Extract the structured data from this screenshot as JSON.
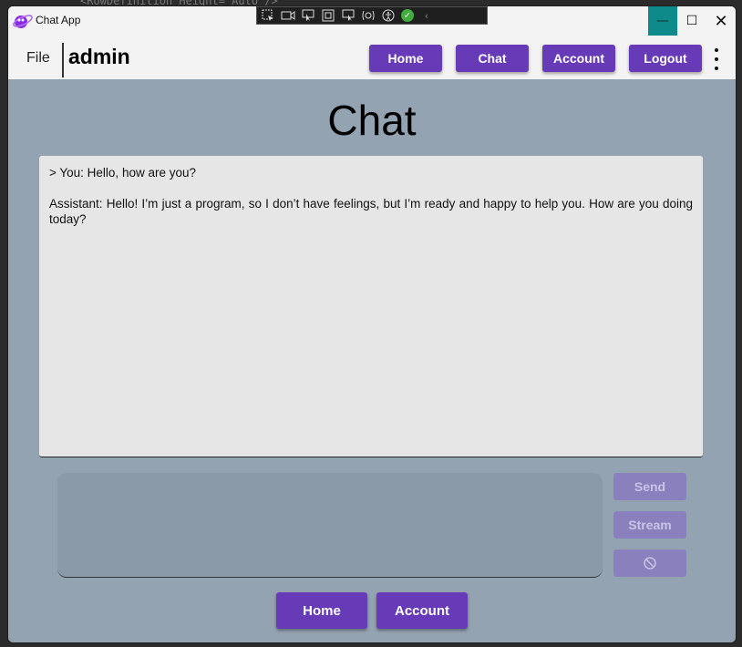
{
  "window": {
    "title": "Chat App",
    "controls": {
      "minimize": "—",
      "maximize": "☐",
      "close": "✕"
    },
    "accent": "#0f8a8a"
  },
  "debug_toolbar": {
    "icons": [
      "select-element-icon",
      "record-icon",
      "pointer-icon",
      "display-layout-icon",
      "track-focus-icon",
      "hot-reload-icon",
      "accessibility-icon",
      "status-ok-icon",
      "collapse-icon"
    ]
  },
  "menubar": {
    "file_label": "File",
    "user_name": "admin",
    "nav": [
      {
        "label": "Home"
      },
      {
        "label": "Chat"
      },
      {
        "label": "Account"
      },
      {
        "label": "Logout"
      }
    ],
    "more_icon": "more-vertical-icon"
  },
  "page": {
    "heading": "Chat"
  },
  "chat": {
    "messages": [
      "> You: Hello, how are you?",
      "Assistant: Hello! I’m just a program, so I don’t have feelings, but I’m ready and happy to help you. How are you doing today?"
    ]
  },
  "composer": {
    "input_value": "",
    "send_label": "Send",
    "stream_label": "Stream",
    "cancel_icon": "cancel-icon"
  },
  "footer_nav": {
    "home_label": "Home",
    "account_label": "Account"
  },
  "colors": {
    "primary": "#673ab7",
    "primary_disabled": "#8a80bd",
    "content_bg": "#94a3b1",
    "panel_bg": "#e6e6e6"
  }
}
